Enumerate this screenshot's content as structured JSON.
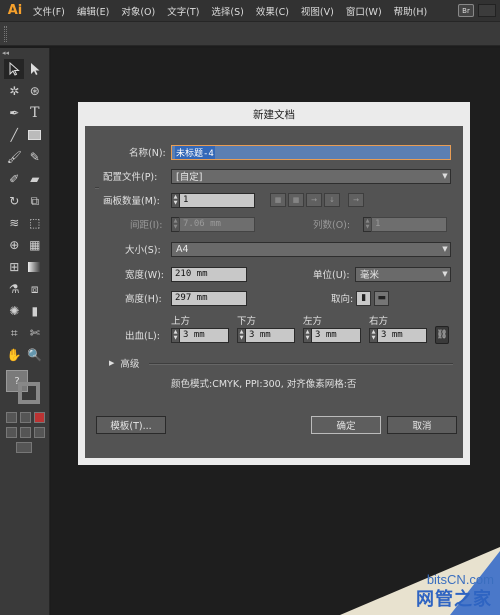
{
  "app": {
    "logo": "Ai"
  },
  "menu": [
    "文件(F)",
    "编辑(E)",
    "对象(O)",
    "文字(T)",
    "选择(S)",
    "效果(C)",
    "视图(V)",
    "窗口(W)",
    "帮助(H)"
  ],
  "menu_right": {
    "bridge": "Br"
  },
  "toolbox": {
    "collapse": "◂◂"
  },
  "dialog": {
    "title": "新建文档",
    "name_label": "名称(N):",
    "name_value": "未标题-4",
    "profile_label": "配置文件(P):",
    "profile_value": "[自定]",
    "artboards_label": "画板数量(M):",
    "artboards_value": "1",
    "spacing_label": "间距(I):",
    "spacing_value": "7.06 mm",
    "columns_label": "列数(O):",
    "columns_value": "1",
    "size_label": "大小(S):",
    "size_value": "A4",
    "width_label": "宽度(W):",
    "width_value": "210 mm",
    "units_label": "单位(U):",
    "units_value": "毫米",
    "height_label": "高度(H):",
    "height_value": "297 mm",
    "orientation_label": "取向:",
    "bleed_label": "出血(L):",
    "bleed": [
      {
        "label": "上方",
        "value": "3 mm"
      },
      {
        "label": "下方",
        "value": "3 mm"
      },
      {
        "label": "左方",
        "value": "3 mm"
      },
      {
        "label": "右方",
        "value": "3 mm"
      }
    ],
    "advanced_label": "高级",
    "info": "颜色模式:CMYK, PPI:300, 对齐像素网格:否",
    "template_button": "模板(T)...",
    "ok_button": "确定",
    "cancel_button": "取消"
  },
  "watermark": {
    "site": "bitsCN.com",
    "cn": "网管之家"
  },
  "colors": {
    "accent_orange": "#f7a12c",
    "selection_blue": "#3468b8",
    "watermark_blue": "#2e64c2"
  }
}
